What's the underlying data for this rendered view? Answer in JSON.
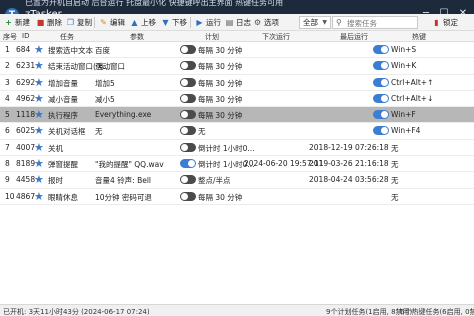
{
  "app": {
    "title": "zTasker",
    "banner": "已置为开机自启动 后台运行 托盘最小化 快捷键呼出主界面 热键任务可用"
  },
  "toolbar": {
    "new_label": "新建",
    "delete_label": "删除",
    "copy_label": "复制",
    "edit_label": "编辑",
    "up_label": "上移",
    "down_label": "下移",
    "run_label": "运行",
    "log_label": "日志",
    "options_label": "选项",
    "filter_value": "全部",
    "search_placeholder": "搜索任务",
    "lock_label": "锁定"
  },
  "columns": {
    "seq": "序号",
    "id": "ID",
    "task": "任务",
    "params": "参数",
    "schedule": "计划",
    "next_run": "下次运行",
    "last_run": "最后运行",
    "hotkey": "热键"
  },
  "rows": [
    {
      "seq": "1",
      "id": "684",
      "starred": true,
      "task": "搜索选中文本",
      "params": "百度",
      "plan_on": false,
      "plan": "每隔 30 分钟",
      "next": "",
      "last": "",
      "hotkey_on": true,
      "hotkey": "Win+S"
    },
    {
      "seq": "2",
      "id": "6231",
      "starred": true,
      "task": "结束活动窗口(强...",
      "params": "活动窗口",
      "plan_on": false,
      "plan": "每隔 30 分钟",
      "next": "",
      "last": "",
      "hotkey_on": true,
      "hotkey": "Win+K"
    },
    {
      "seq": "3",
      "id": "6292",
      "starred": true,
      "task": "增加音量",
      "params": "增加5",
      "plan_on": false,
      "plan": "每隔 30 分钟",
      "next": "",
      "last": "",
      "hotkey_on": true,
      "hotkey": "Ctrl+Alt+↑"
    },
    {
      "seq": "4",
      "id": "4962",
      "starred": true,
      "task": "减小音量",
      "params": "减小5",
      "plan_on": false,
      "plan": "每隔 30 分钟",
      "next": "",
      "last": "",
      "hotkey_on": true,
      "hotkey": "Ctrl+Alt+↓"
    },
    {
      "seq": "5",
      "id": "1118",
      "starred": true,
      "task": "执行程序",
      "params": "Everything.exe",
      "plan_on": false,
      "plan": "每隔 30 分钟",
      "next": "",
      "last": "",
      "hotkey_on": true,
      "hotkey": "Win+F"
    },
    {
      "seq": "6",
      "id": "6025",
      "starred": true,
      "task": "关机对话框",
      "params": "无",
      "plan_on": false,
      "plan": "无",
      "next": "",
      "last": "",
      "hotkey_on": true,
      "hotkey": "Win+F4"
    },
    {
      "seq": "7",
      "id": "4007",
      "starred": true,
      "task": "关机",
      "params": "",
      "plan_on": false,
      "plan": "倒计时 1小时0...",
      "next": "",
      "last": "2018-12-19 07:26:18",
      "hotkey_on": null,
      "hotkey": "无"
    },
    {
      "seq": "8",
      "id": "8189",
      "starred": true,
      "task": "弹窗提醒",
      "params": "\"我的提醒\" QQ.wav",
      "plan_on": true,
      "plan": "倒计时 1小时0...",
      "next": "2024-06-20 19:57:11",
      "last": "2019-03-26 21:16:18",
      "hotkey_on": null,
      "hotkey": "无"
    },
    {
      "seq": "9",
      "id": "4458",
      "starred": true,
      "task": "报时",
      "params": "音量4 铃声: Bell",
      "plan_on": false,
      "plan": "整点/半点",
      "next": "",
      "last": "2018-04-24 03:56:28",
      "hotkey_on": null,
      "hotkey": "无"
    },
    {
      "seq": "10",
      "id": "4867",
      "starred": true,
      "task": "眼睛休息",
      "params": "10分钟 密码可退",
      "plan_on": false,
      "plan": "每隔 30 分钟",
      "next": "",
      "last": "",
      "hotkey_on": null,
      "hotkey": "无"
    }
  ],
  "selected_row": 4,
  "status": {
    "uptime": "已开机: 3天11小时43分 (2024-06-17 07:24)",
    "scheduled": "9个计划任务(1启用, 8禁用)",
    "hotkeys": "6个热键任务(6启用, 0禁用)"
  },
  "colors": {
    "titlebar": "#1c2a3c",
    "accent": "#3c7fd2",
    "selected_row": "#b7b7b7"
  }
}
